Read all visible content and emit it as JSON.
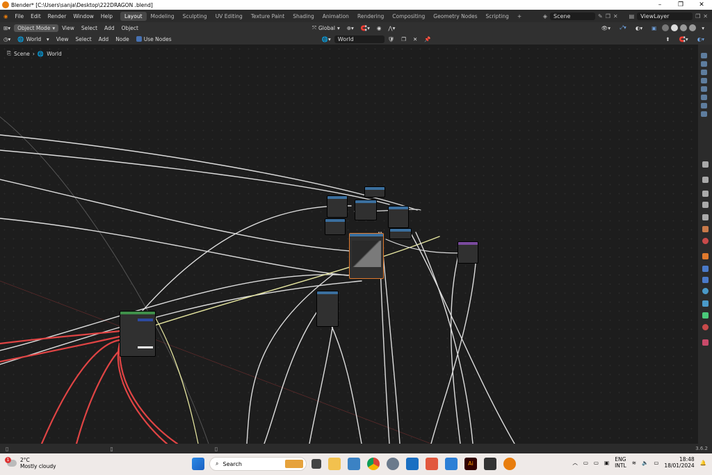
{
  "titlebar": {
    "title": "Blender* [C:\\Users\\sanja\\Desktop\\222DRAGON .blend]"
  },
  "menu": [
    "File",
    "Edit",
    "Render",
    "Window",
    "Help"
  ],
  "workspaces": [
    "Layout",
    "Modeling",
    "Sculpting",
    "UV Editing",
    "Texture Paint",
    "Shading",
    "Animation",
    "Rendering",
    "Compositing",
    "Geometry Nodes",
    "Scripting"
  ],
  "active_workspace": "Layout",
  "scene": "Scene",
  "view_layer": "ViewLayer",
  "header1": {
    "mode": "Object Mode",
    "menus": [
      "View",
      "Select",
      "Add",
      "Object"
    ],
    "transform": "Global"
  },
  "header2": {
    "type": "World",
    "menus": [
      "View",
      "Select",
      "Add",
      "Node"
    ],
    "use_nodes": "Use Nodes",
    "world_name": "World"
  },
  "breadcrumb": {
    "scene": "Scene",
    "world": "World"
  },
  "status": {
    "version": "3.6.2"
  },
  "taskbar": {
    "temp": "2°C",
    "weather": "Mostly cloudy",
    "notif": "1",
    "search": "Search",
    "lang1": "ENG",
    "lang2": "INTL",
    "time": "18:48",
    "date": "18/01/2024"
  },
  "colors": {
    "accent": "#4772b3",
    "selected_node": "#e07a2d",
    "active_ws": "#474747",
    "link_red": "#e04444"
  }
}
